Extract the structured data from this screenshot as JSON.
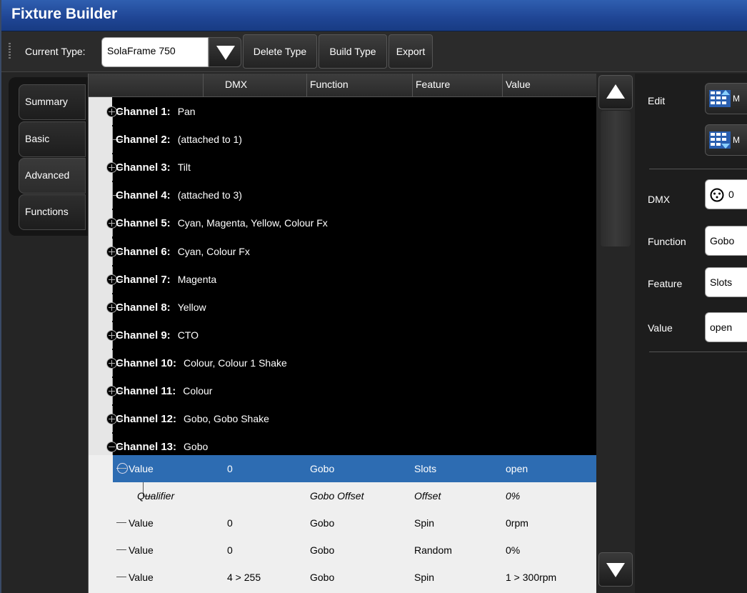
{
  "window": {
    "title": "Fixture Builder"
  },
  "toolbar": {
    "current_type_label": "Current Type:",
    "current_type_value": "SolaFrame 750",
    "delete_type": "Delete Type",
    "build_type": "Build Type",
    "export": "Export"
  },
  "tabs": [
    {
      "label": "Summary"
    },
    {
      "label": "Basic"
    },
    {
      "label": "Advanced",
      "active": true
    },
    {
      "label": "Functions"
    }
  ],
  "columns": [
    "DMX",
    "Function",
    "Feature",
    "Value"
  ],
  "channels": [
    {
      "name": "Channel 1:",
      "desc": "Pan",
      "expander": "plus"
    },
    {
      "name": "Channel 2:",
      "desc": "(attached to 1)",
      "expander": "none"
    },
    {
      "name": "Channel 3:",
      "desc": "Tilt",
      "expander": "plus"
    },
    {
      "name": "Channel 4:",
      "desc": "(attached to 3)",
      "expander": "none"
    },
    {
      "name": "Channel 5:",
      "desc": "Cyan, Magenta, Yellow, Colour Fx",
      "expander": "plus"
    },
    {
      "name": "Channel 6:",
      "desc": "Cyan, Colour Fx",
      "expander": "plus"
    },
    {
      "name": "Channel 7:",
      "desc": "Magenta",
      "expander": "plus"
    },
    {
      "name": "Channel 8:",
      "desc": "Yellow",
      "expander": "plus"
    },
    {
      "name": "Channel 9:",
      "desc": "CTO",
      "expander": "plus"
    },
    {
      "name": "Channel 10:",
      "desc": "Colour, Colour 1 Shake",
      "expander": "plus"
    },
    {
      "name": "Channel 11:",
      "desc": "Colour",
      "expander": "plus"
    },
    {
      "name": "Channel 12:",
      "desc": "Gobo, Gobo Shake",
      "expander": "plus"
    },
    {
      "name": "Channel 13:",
      "desc": "Gobo",
      "expander": "minus"
    }
  ],
  "value_rows": [
    {
      "label": "Value",
      "dmx": "0",
      "function": "Gobo",
      "feature": "Slots",
      "value": "open",
      "selected": true,
      "expander": "minus"
    },
    {
      "label": "Qualifier",
      "dmx": "",
      "function": "Gobo Offset",
      "feature": "Offset",
      "value": "0%",
      "italic": true
    },
    {
      "label": "Value",
      "dmx": "0",
      "function": "Gobo",
      "feature": "Spin",
      "value": "0rpm"
    },
    {
      "label": "Value",
      "dmx": "0",
      "function": "Gobo",
      "feature": "Random",
      "value": "0%"
    },
    {
      "label": "Value",
      "dmx": "4 > 255",
      "function": "Gobo",
      "feature": "Spin",
      "value": "1 > 300rpm"
    }
  ],
  "editor": {
    "edit_label": "Edit",
    "move_up_label": "M",
    "move_down_label": "M",
    "dmx_label": "DMX",
    "dmx_value": "0",
    "function_label": "Function",
    "function_value": "Gobo",
    "feature_label": "Feature",
    "feature_value": "Slots",
    "value_label": "Value",
    "value_value": "open"
  }
}
